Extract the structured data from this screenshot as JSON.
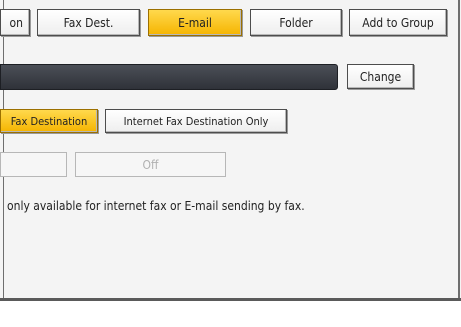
{
  "tabs": {
    "partial_tab_label": "on",
    "fax_dest_label": "Fax Dest.",
    "email_label": "E-mail",
    "folder_label": "Folder",
    "add_to_group_label": "Add to Group"
  },
  "destination": {
    "change_label": "Change"
  },
  "send_mode": {
    "fax_destination_label": "Fax Destination",
    "internet_fax_only_label": "Internet Fax Destination Only"
  },
  "toggle": {
    "on_label": "",
    "off_label": "Off"
  },
  "note_text": "only available for internet fax or E-mail sending by fax.",
  "colors": {
    "selected": "#f5b400",
    "field_dark": "#3a3d44"
  }
}
